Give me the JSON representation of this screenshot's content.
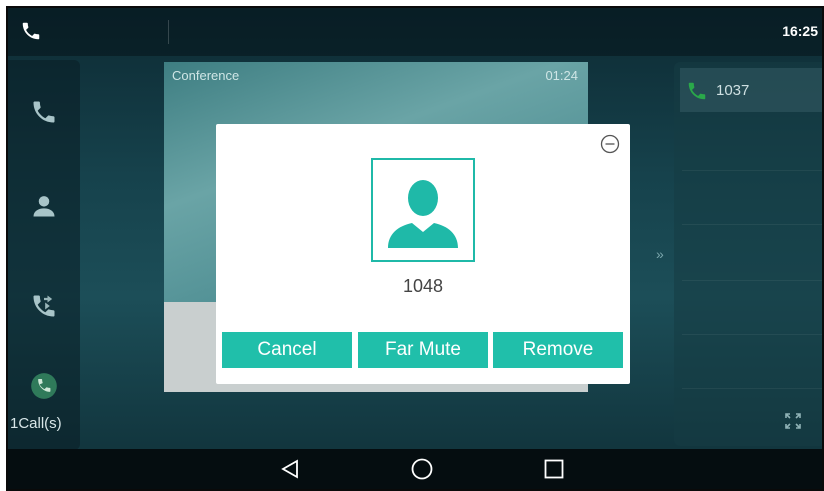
{
  "status_bar": {
    "clock": "16:25"
  },
  "left_sidebar": {
    "items": [
      {
        "icon": "phone-icon"
      },
      {
        "icon": "contacts-icon"
      },
      {
        "icon": "call-forward-icon"
      },
      {
        "icon": "active-call-icon"
      }
    ],
    "calls_label": "1Call(s)"
  },
  "conference": {
    "title": "Conference",
    "timer": "01:24"
  },
  "right_panel": {
    "contact_number": "1037"
  },
  "dialog": {
    "number": "1048",
    "buttons": {
      "cancel": "Cancel",
      "far_mute": "Far Mute",
      "remove": "Remove"
    }
  },
  "colors": {
    "accent": "#20bfaa",
    "accent_border": "#1fb9a8",
    "contact_icon": "#2aa84a"
  }
}
